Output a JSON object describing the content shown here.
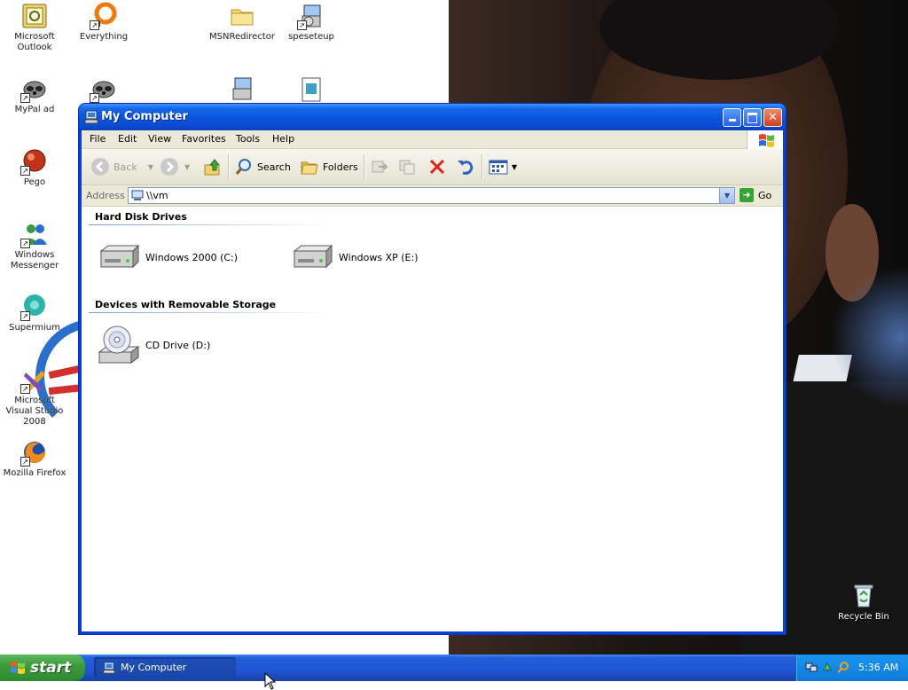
{
  "desktop": {
    "icons": [
      {
        "label": "Microsoft Outlook",
        "icon": "outlook-icon"
      },
      {
        "label": "Everything",
        "icon": "everything-icon"
      },
      {
        "label": "MSNRedirector",
        "icon": "folder-icon"
      },
      {
        "label": "speseteup",
        "icon": "setup-installer-icon"
      },
      {
        "label": "MyPal ad",
        "icon": "raccoon-icon"
      },
      {
        "label": "Pego",
        "icon": "red-ball-icon"
      },
      {
        "label": "Windows Messenger",
        "icon": "messenger-icon"
      },
      {
        "label": "Supermium",
        "icon": "supermium-icon"
      },
      {
        "label": "Microsoft Visual Studio 2008",
        "icon": "visual-studio-icon"
      },
      {
        "label": "Mozilla Firefox",
        "icon": "firefox-icon"
      },
      {
        "label": "Recycle Bin",
        "icon": "recycle-bin-icon"
      }
    ]
  },
  "window": {
    "title": "My Computer",
    "menu": [
      "File",
      "Edit",
      "View",
      "Favorites",
      "Tools",
      "Help"
    ],
    "toolbar": {
      "back": "Back",
      "search": "Search",
      "folders": "Folders"
    },
    "address": {
      "label": "Address",
      "value": "\\\\vm",
      "go": "Go"
    },
    "groups": [
      {
        "title": "Hard Disk Drives",
        "items": [
          {
            "label": "Windows 2000 (C:)",
            "icon": "hard-drive-icon"
          },
          {
            "label": "Windows XP (E:)",
            "icon": "hard-drive-icon"
          }
        ]
      },
      {
        "title": "Devices with Removable Storage",
        "items": [
          {
            "label": "CD Drive (D:)",
            "icon": "cd-drive-icon"
          }
        ]
      }
    ]
  },
  "taskbar": {
    "start": "start",
    "tasks": [
      {
        "label": "My Computer",
        "icon": "my-computer-icon"
      }
    ],
    "clock": "5:36 AM"
  },
  "colors": {
    "title_blue": "#0a54da",
    "taskbar_blue": "#245edb",
    "start_green": "#3d9c3d",
    "close_red": "#d2401e",
    "tray_blue": "#0f7ad8"
  }
}
